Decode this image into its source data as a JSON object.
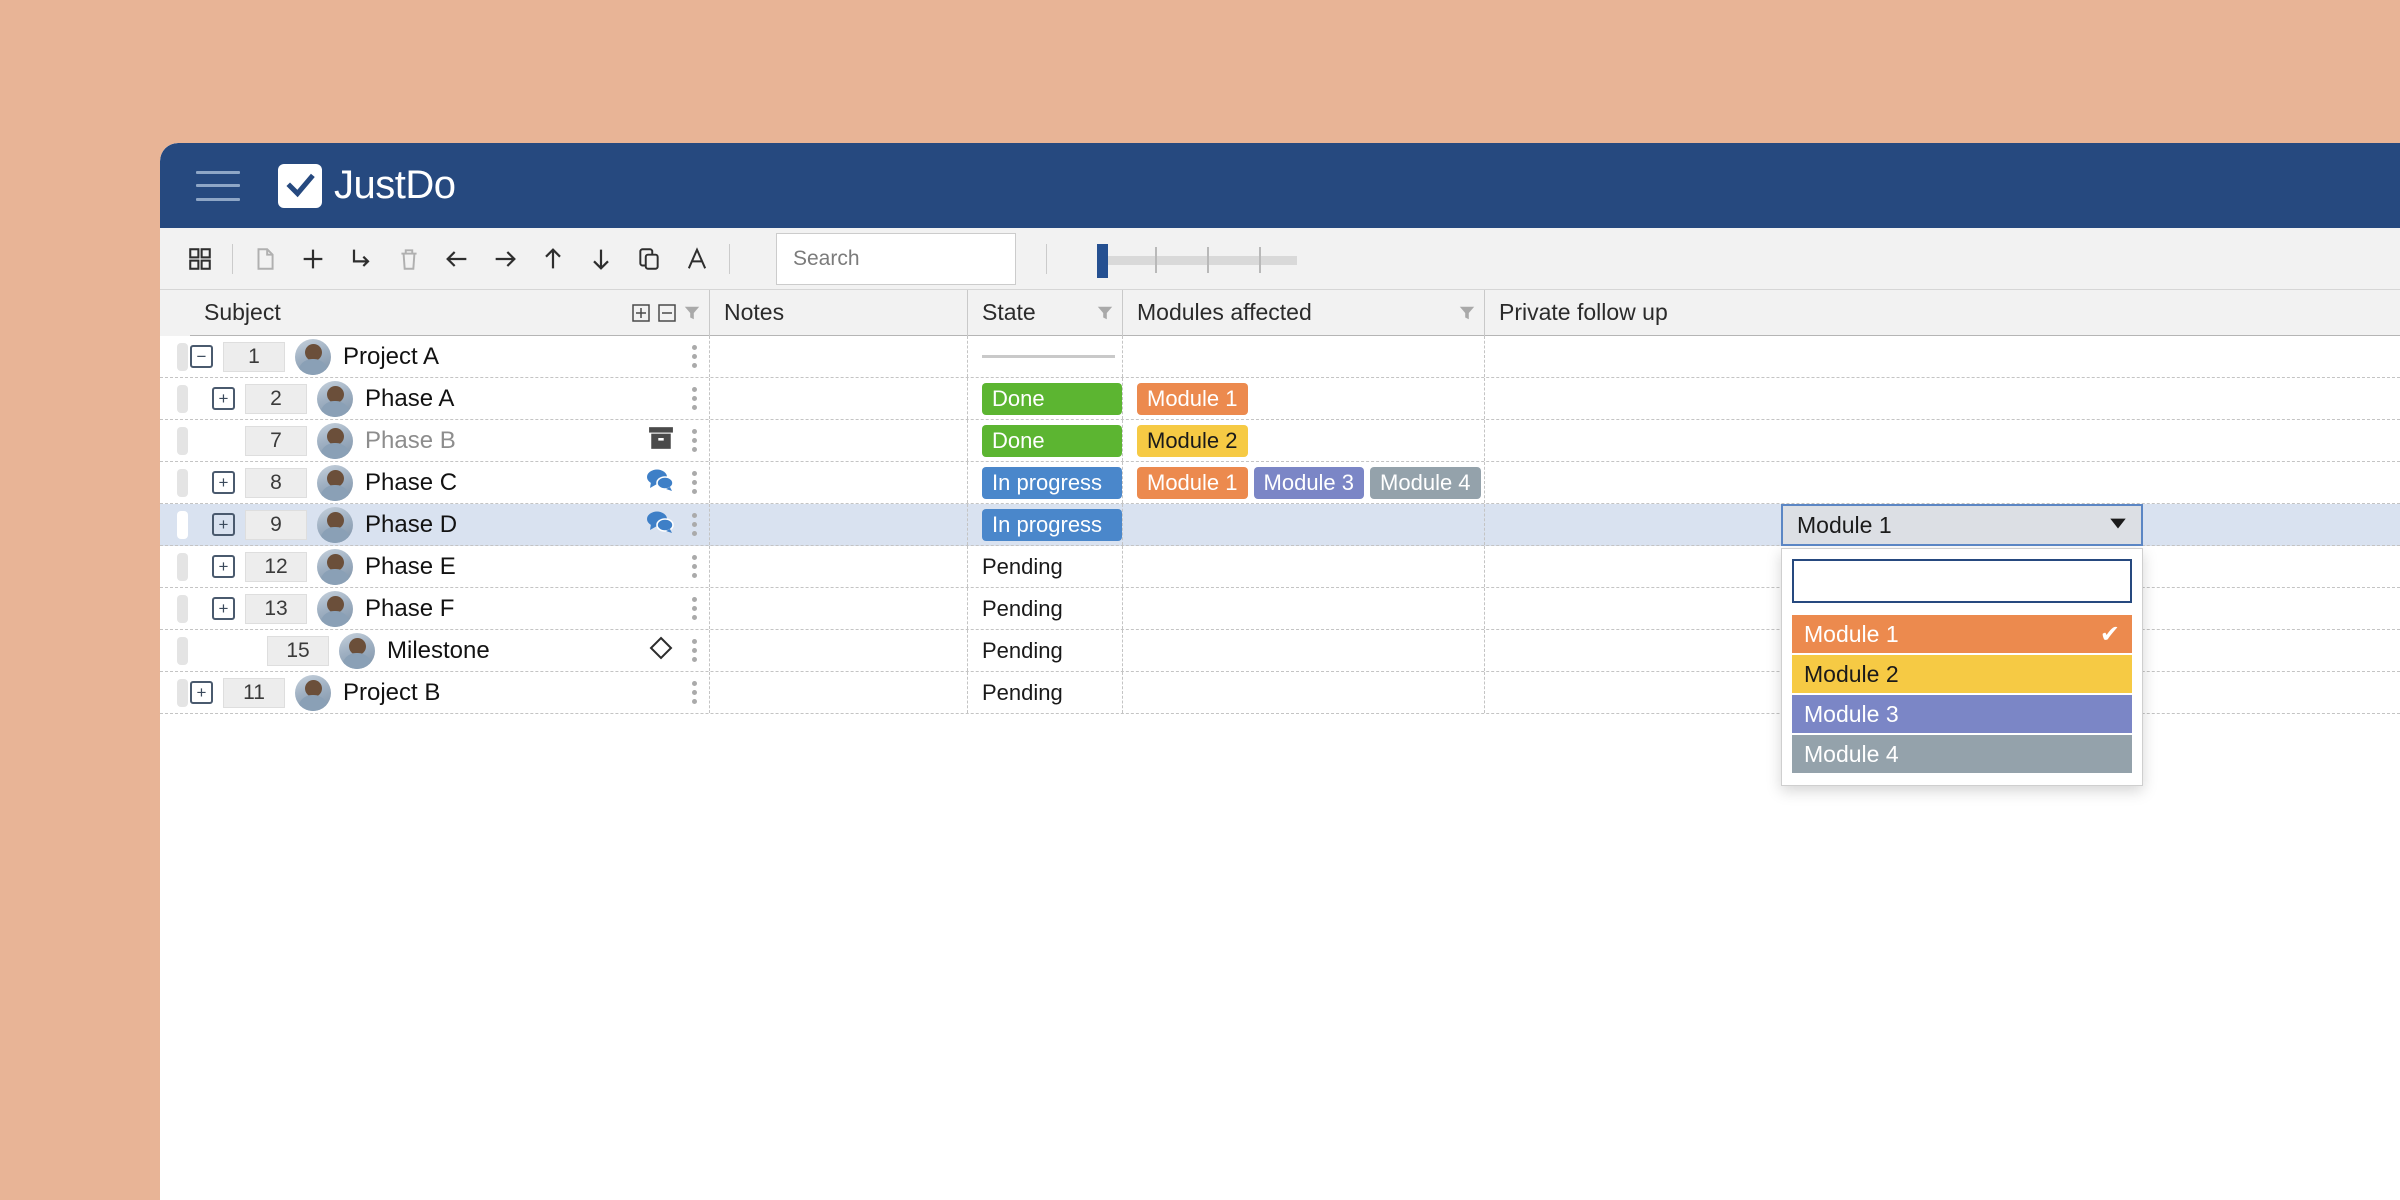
{
  "theme": {
    "page_background": "#e8b496",
    "header_background": "#26497f",
    "accent": "#255091",
    "selection_row": "#d9e2f0"
  },
  "header": {
    "menu_icon": "hamburger-icon",
    "logo_icon": "checkbox-check-icon",
    "brand_name": "JustDo"
  },
  "toolbar": {
    "buttons": [
      {
        "name": "grid-view-button",
        "icon": "grid-squares-icon"
      },
      {
        "name": "new-document-button",
        "icon": "document-icon"
      },
      {
        "name": "add-task-button",
        "icon": "plus-icon"
      },
      {
        "name": "add-subtask-button",
        "icon": "arrow-branch-icon"
      },
      {
        "name": "delete-button",
        "icon": "trash-icon"
      },
      {
        "name": "outdent-button",
        "icon": "arrow-left-icon"
      },
      {
        "name": "indent-button",
        "icon": "arrow-right-icon"
      },
      {
        "name": "move-up-button",
        "icon": "arrow-up-icon"
      },
      {
        "name": "move-down-button",
        "icon": "arrow-down-icon"
      },
      {
        "name": "duplicate-button",
        "icon": "copy-icon"
      },
      {
        "name": "text-format-button",
        "icon": "letter-a-icon"
      }
    ],
    "search": {
      "placeholder": "Search",
      "value": ""
    },
    "zoom_slider": {
      "value": 0,
      "ticks": 3
    }
  },
  "grid": {
    "columns": [
      {
        "key": "subject",
        "label": "Subject",
        "tools": [
          "expand-all-icon",
          "collapse-all-icon",
          "filter-icon"
        ]
      },
      {
        "key": "notes",
        "label": "Notes",
        "tools": []
      },
      {
        "key": "state",
        "label": "State",
        "tools": [
          "filter-icon"
        ]
      },
      {
        "key": "modules",
        "label": "Modules affected",
        "tools": [
          "filter-icon"
        ]
      },
      {
        "key": "private",
        "label": "Private follow up",
        "tools": []
      }
    ],
    "rows": [
      {
        "id": "1",
        "title": "Project A",
        "depth": 0,
        "toggle": "minus",
        "muted": false,
        "icons": [],
        "notes": "",
        "state": {
          "type": "rule",
          "label": ""
        },
        "modules": [],
        "selected": false
      },
      {
        "id": "2",
        "title": "Phase A",
        "depth": 1,
        "toggle": "plus",
        "muted": false,
        "icons": [],
        "notes": "",
        "state": {
          "type": "badge",
          "label": "Done",
          "color": "#5cb531"
        },
        "modules": [
          {
            "label": "Module 1",
            "color": "#ec8a4e",
            "text": "#ffffff"
          }
        ],
        "selected": false
      },
      {
        "id": "7",
        "title": "Phase B",
        "depth": 1,
        "toggle": "none",
        "muted": true,
        "icons": [
          "archive-box-icon"
        ],
        "notes": "",
        "state": {
          "type": "badge",
          "label": "Done",
          "color": "#5cb531"
        },
        "modules": [
          {
            "label": "Module 2",
            "color": "#f6ca44",
            "text": "#1a1a1a"
          }
        ],
        "selected": false
      },
      {
        "id": "8",
        "title": "Phase C",
        "depth": 1,
        "toggle": "plus",
        "muted": false,
        "icons": [
          "comments-icon"
        ],
        "notes": "",
        "state": {
          "type": "badge",
          "label": "In progress",
          "color": "#4a87cb"
        },
        "modules": [
          {
            "label": "Module 1",
            "color": "#ec8a4e",
            "text": "#ffffff"
          },
          {
            "label": "Module 3",
            "color": "#7b86c6",
            "text": "#ffffff"
          },
          {
            "label": "Module 4",
            "color": "#94a2ab",
            "text": "#ffffff"
          }
        ],
        "selected": false
      },
      {
        "id": "9",
        "title": "Phase D",
        "depth": 1,
        "toggle": "plus",
        "muted": false,
        "icons": [
          "comments-icon"
        ],
        "notes": "",
        "state": {
          "type": "badge",
          "label": "In progress",
          "color": "#4a87cb"
        },
        "modules": [],
        "selected": true
      },
      {
        "id": "12",
        "title": "Phase E",
        "depth": 1,
        "toggle": "plus",
        "muted": false,
        "icons": [],
        "notes": "",
        "state": {
          "type": "text",
          "label": "Pending"
        },
        "modules": [],
        "selected": false
      },
      {
        "id": "13",
        "title": "Phase F",
        "depth": 1,
        "toggle": "plus",
        "muted": false,
        "icons": [],
        "notes": "",
        "state": {
          "type": "text",
          "label": "Pending"
        },
        "modules": [],
        "selected": false
      },
      {
        "id": "15",
        "title": "Milestone",
        "depth": 2,
        "toggle": "none",
        "muted": false,
        "icons": [
          "diamond-icon"
        ],
        "notes": "",
        "state": {
          "type": "text",
          "label": "Pending"
        },
        "modules": [],
        "selected": false
      },
      {
        "id": "11",
        "title": "Project B",
        "depth": 0,
        "toggle": "plus",
        "muted": false,
        "icons": [],
        "notes": "",
        "state": {
          "type": "text",
          "label": "Pending"
        },
        "modules": [],
        "selected": false
      }
    ]
  },
  "dropdown": {
    "open": true,
    "editor_value": "Module 1",
    "caret_icon": "caret-down-icon",
    "filter_placeholder": "",
    "filter_value": "",
    "options": [
      {
        "label": "Module 1",
        "color": "#ec8a4e",
        "text": "#ffffff",
        "checked": true
      },
      {
        "label": "Module 2",
        "color": "#f6ca44",
        "text": "#1a1a1a",
        "checked": false
      },
      {
        "label": "Module 3",
        "color": "#7b86c6",
        "text": "#ffffff",
        "checked": false
      },
      {
        "label": "Module 4",
        "color": "#94a2ab",
        "text": "#ffffff",
        "checked": false
      }
    ],
    "check_glyph": "✔"
  }
}
